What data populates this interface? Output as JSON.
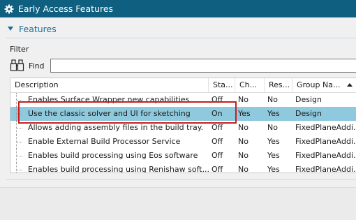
{
  "window": {
    "title": "Early Access Features",
    "icon": "gear-icon"
  },
  "section": {
    "title": "Features",
    "expanded": true
  },
  "filter": {
    "label": "Filter",
    "find_label": "Find",
    "find_value": "",
    "find_icon": "binoculars-icon"
  },
  "table": {
    "columns": [
      "Description",
      "Sta...",
      "Ch...",
      "Res...",
      "Group Na..."
    ],
    "sort_column": "Group Na...",
    "sort_direction": "ascending",
    "rows": [
      {
        "description": "Enables Surface Wrapper new capabilities",
        "state": "Off",
        "ch": "No",
        "res": "No",
        "group": "Design",
        "selected": false
      },
      {
        "description": "Use the classic solver and UI for sketching",
        "state": "On",
        "ch": "Yes",
        "res": "Yes",
        "group": "Design",
        "selected": true
      },
      {
        "description": "Allows adding assembly files in the build tray.",
        "state": "Off",
        "ch": "No",
        "res": "No",
        "group": "FixedPlaneAddi...",
        "selected": false
      },
      {
        "description": "Enable External Build Processor Service",
        "state": "Off",
        "ch": "No",
        "res": "Yes",
        "group": "FixedPlaneAddi...",
        "selected": false
      },
      {
        "description": "Enables build processing using Eos software",
        "state": "Off",
        "ch": "No",
        "res": "Yes",
        "group": "FixedPlaneAddi...",
        "selected": false
      },
      {
        "description": "Enables build processing using Renishaw soft...",
        "state": "Off",
        "ch": "No",
        "res": "Yes",
        "group": "FixedPlaneAddi...",
        "selected": false
      }
    ]
  },
  "colors": {
    "titlebar": "#0f5f80",
    "accent": "#1f6d96",
    "selection": "#8ec9dd",
    "highlight_box": "#c81e1e"
  }
}
